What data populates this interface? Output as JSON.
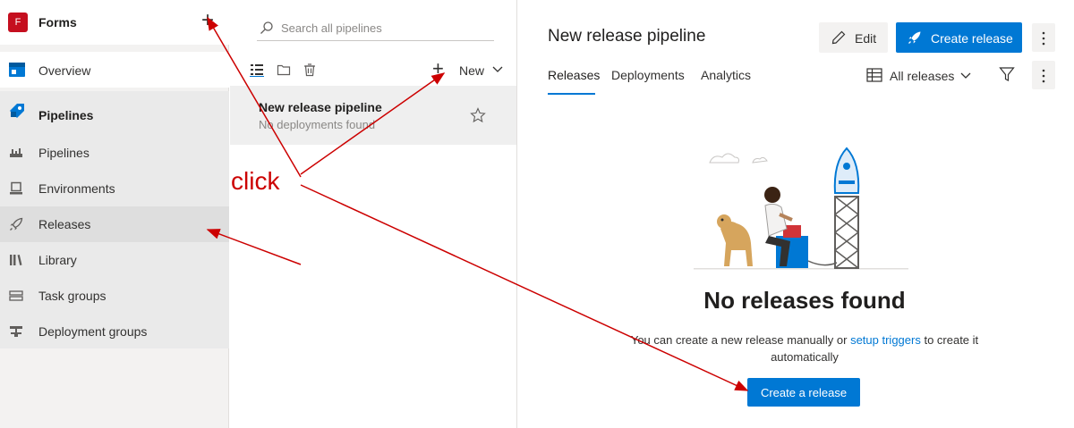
{
  "sidebar": {
    "project_name": "Forms",
    "project_initial": "F",
    "overview_label": "Overview",
    "group_label": "Pipelines",
    "items": [
      {
        "label": "Pipelines",
        "icon": "pipelines-icon"
      },
      {
        "label": "Environments",
        "icon": "environments-icon"
      },
      {
        "label": "Releases",
        "icon": "releases-rocket-icon",
        "selected": true
      },
      {
        "label": "Library",
        "icon": "library-icon"
      },
      {
        "label": "Task groups",
        "icon": "task-groups-icon"
      },
      {
        "label": "Deployment groups",
        "icon": "deployment-groups-icon"
      }
    ]
  },
  "list_pane": {
    "search_placeholder": "Search all pipelines",
    "new_label": "New",
    "pipeline": {
      "title": "New release pipeline",
      "subtitle": "No deployments found"
    }
  },
  "main": {
    "title": "New release pipeline",
    "edit_label": "Edit",
    "create_label": "Create release",
    "tabs": [
      "Releases",
      "Deployments",
      "Analytics"
    ],
    "active_tab": "Releases",
    "filter_label": "All releases",
    "empty_title": "No releases found",
    "empty_desc_before": "You can create a new release manually or ",
    "empty_desc_link": "setup triggers",
    "empty_desc_after": " to create it automatically",
    "create_a_release_label": "Create a release"
  },
  "annotation": {
    "text": "click",
    "color": "#cc0000"
  },
  "colors": {
    "accent": "#0078d4",
    "project_avatar": "#c50f1f"
  }
}
